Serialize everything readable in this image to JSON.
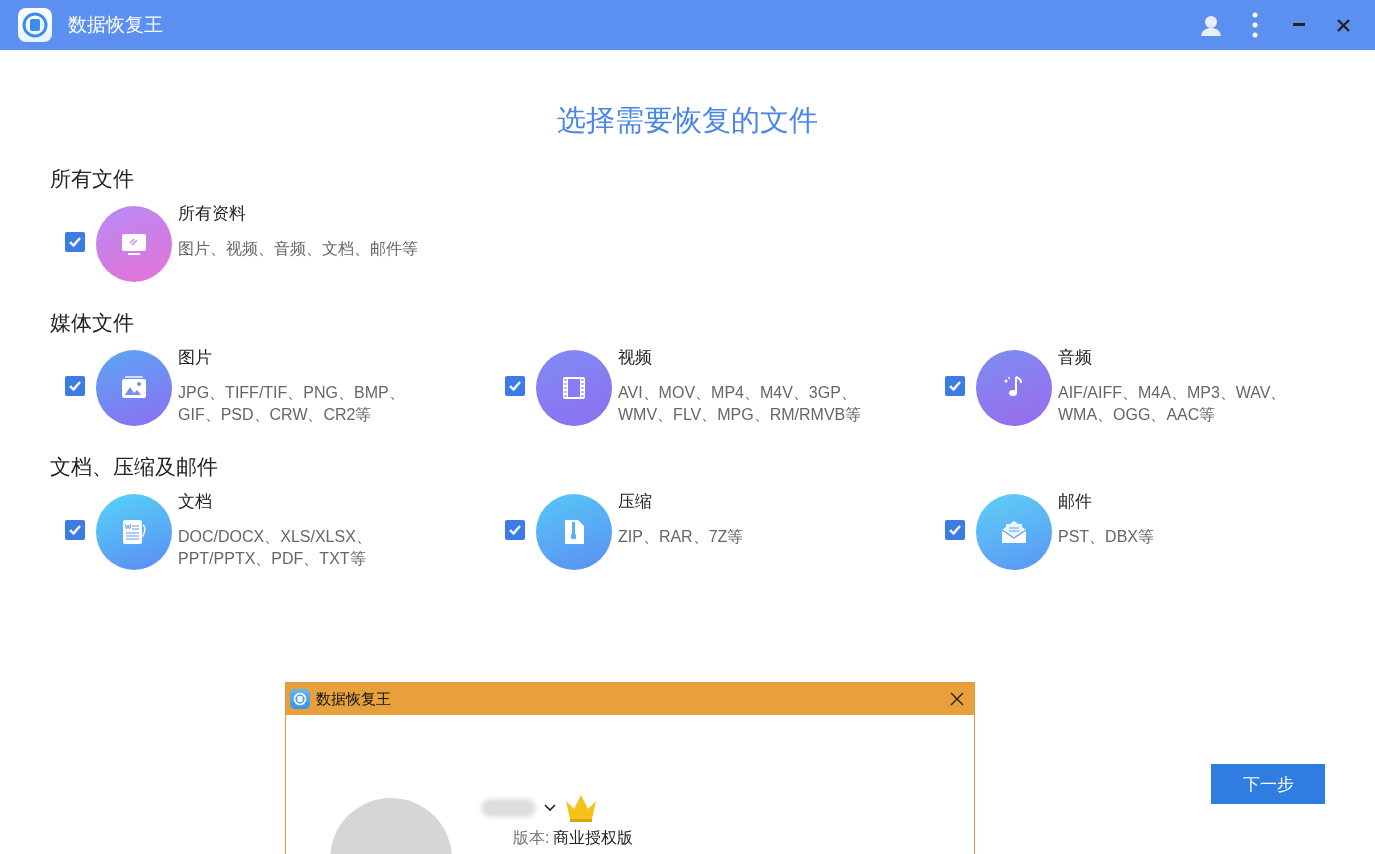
{
  "window": {
    "title": "数据恢复王"
  },
  "heading": "选择需要恢复的文件",
  "sections": [
    {
      "title": "所有文件",
      "items": [
        {
          "kind": "all",
          "name": "所有资料",
          "desc": "图片、视频、音频、文档、邮件等",
          "checked": true
        }
      ]
    },
    {
      "title": "媒体文件",
      "items": [
        {
          "kind": "image",
          "name": "图片",
          "desc": "JPG、TIFF/TIF、PNG、BMP、GIF、PSD、CRW、CR2等",
          "checked": true
        },
        {
          "kind": "video",
          "name": "视频",
          "desc": "AVI、MOV、MP4、M4V、3GP、WMV、FLV、MPG、RM/RMVB等",
          "checked": true
        },
        {
          "kind": "audio",
          "name": "音频",
          "desc": "AIF/AIFF、M4A、MP3、WAV、WMA、OGG、AAC等",
          "checked": true
        }
      ]
    },
    {
      "title": "文档、压缩及邮件",
      "items": [
        {
          "kind": "doc",
          "name": "文档",
          "desc": "DOC/DOCX、XLS/XLSX、PPT/PPTX、PDF、TXT等",
          "checked": true
        },
        {
          "kind": "zip",
          "name": "压缩",
          "desc": "ZIP、RAR、7Z等",
          "checked": true
        },
        {
          "kind": "mail",
          "name": "邮件",
          "desc": "PST、DBX等",
          "checked": true
        }
      ]
    }
  ],
  "next_button": "下一步",
  "dialog": {
    "title": "数据恢复王",
    "version_label": "版本:",
    "version_value": "商业授权版"
  }
}
